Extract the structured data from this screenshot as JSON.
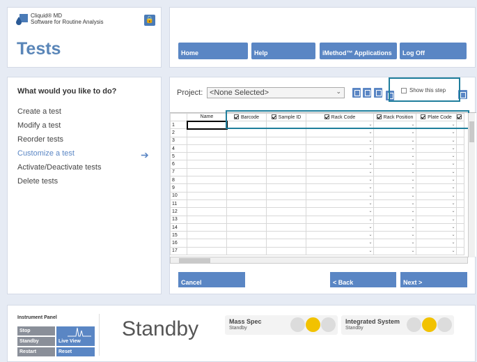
{
  "brand": {
    "line1": "Cliquid® MD",
    "line2": "Software for Routine Analysis"
  },
  "page_title": "Tests",
  "nav": {
    "home": "Home",
    "help": "Help",
    "imethod": "iMethod™ Applications",
    "logoff": "Log Off"
  },
  "left": {
    "heading": "What would you like to do?",
    "items": [
      "Create a test",
      "Modify a test",
      "Reorder tests",
      "Customize a test",
      "Activate/Deactivate tests",
      "Delete tests"
    ],
    "active_index": 3
  },
  "project": {
    "label": "Project:",
    "value": "<None Selected>"
  },
  "show_step": {
    "label": "Show this step"
  },
  "grid": {
    "columns": [
      "Name",
      "Barcode",
      "Sample ID",
      "Rack Code",
      "Rack Position",
      "Plate Code"
    ],
    "rows": [
      "1",
      "2",
      "3",
      "4",
      "5",
      "6",
      "7",
      "8",
      "9",
      "10",
      "11",
      "12",
      "13",
      "14",
      "15",
      "16",
      "17"
    ]
  },
  "buttons": {
    "cancel": "Cancel",
    "back": "< Back",
    "next": "Next >"
  },
  "instrument": {
    "label": "Instrument Panel",
    "stop": "Stop",
    "standby": "Standby",
    "restart": "Restart",
    "live_view": "Live View",
    "reset": "Reset",
    "status": "Standby",
    "mass_spec": {
      "name": "Mass Spec",
      "status": "Standby"
    },
    "integrated": {
      "name": "Integrated System",
      "status": "Standby"
    }
  },
  "colors": {
    "accent": "#5a86c4",
    "highlight": "#1f7e9c",
    "indicator_active": "#f2c200",
    "indicator_idle": "#dcdcdc"
  }
}
